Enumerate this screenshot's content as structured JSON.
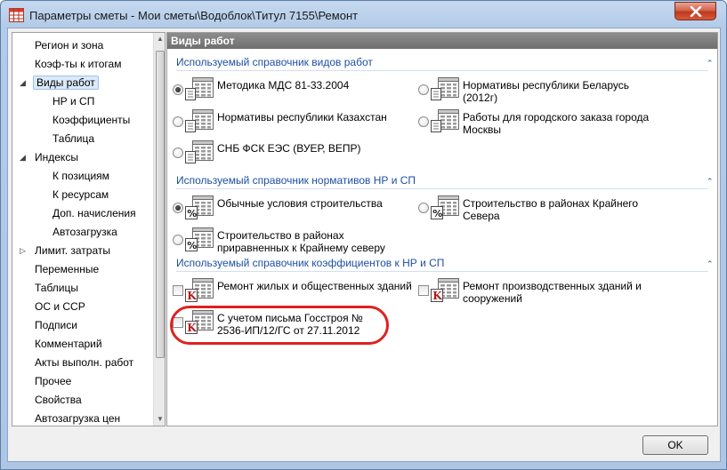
{
  "window": {
    "title": "Параметры сметы - Мои сметы\\Водоблок\\Титул 7155\\Ремонт"
  },
  "sidebar": {
    "items": [
      {
        "label": "Регион и зона",
        "level": 0,
        "expander": "",
        "selected": false
      },
      {
        "label": "Коэф-ты к итогам",
        "level": 0,
        "expander": "",
        "selected": false
      },
      {
        "label": "Виды работ",
        "level": 0,
        "expander": "expanded",
        "selected": true
      },
      {
        "label": "НР и СП",
        "level": 1,
        "expander": "",
        "selected": false
      },
      {
        "label": "Коэффициенты",
        "level": 1,
        "expander": "",
        "selected": false
      },
      {
        "label": "Таблица",
        "level": 1,
        "expander": "",
        "selected": false
      },
      {
        "label": "Индексы",
        "level": 0,
        "expander": "expanded",
        "selected": false
      },
      {
        "label": "К позициям",
        "level": 1,
        "expander": "",
        "selected": false
      },
      {
        "label": "К ресурсам",
        "level": 1,
        "expander": "",
        "selected": false
      },
      {
        "label": "Доп. начисления",
        "level": 1,
        "expander": "",
        "selected": false
      },
      {
        "label": "Автозагрузка",
        "level": 1,
        "expander": "",
        "selected": false
      },
      {
        "label": "Лимит. затраты",
        "level": 0,
        "expander": "collapsed",
        "selected": false
      },
      {
        "label": "Переменные",
        "level": 0,
        "expander": "",
        "selected": false
      },
      {
        "label": "Таблицы",
        "level": 0,
        "expander": "",
        "selected": false
      },
      {
        "label": "ОС и ССР",
        "level": 0,
        "expander": "",
        "selected": false
      },
      {
        "label": "Подписи",
        "level": 0,
        "expander": "",
        "selected": false
      },
      {
        "label": "Комментарий",
        "level": 0,
        "expander": "",
        "selected": false
      },
      {
        "label": "Акты выполн. работ",
        "level": 0,
        "expander": "",
        "selected": false
      },
      {
        "label": "Прочее",
        "level": 0,
        "expander": "",
        "selected": false
      },
      {
        "label": "Свойства",
        "level": 0,
        "expander": "",
        "selected": false
      },
      {
        "label": "Автозагрузка цен",
        "level": 0,
        "expander": "",
        "selected": false
      }
    ]
  },
  "panel": {
    "header": "Виды работ",
    "groups": [
      {
        "title": "Используемый справочник видов работ",
        "options": [
          {
            "label": "Методика МДС 81-33.2004",
            "type": "radio",
            "checked": true,
            "icon": "table-doc-icon"
          },
          {
            "label": "Нормативы республики Беларусь (2012г)",
            "type": "radio",
            "checked": false,
            "icon": "table-doc-icon"
          },
          {
            "label": "Нормативы республики Казахстан",
            "type": "radio",
            "checked": false,
            "icon": "table-doc-icon"
          },
          {
            "label": "Работы для городского заказа города Москвы",
            "type": "radio",
            "checked": false,
            "icon": "table-doc-icon"
          },
          {
            "label": "СНБ ФСК ЕЭС (ВУЕР, ВЕПР)",
            "type": "radio",
            "checked": false,
            "icon": "table-doc-icon"
          }
        ]
      },
      {
        "title": "Используемый справочник нормативов НР и СП",
        "options": [
          {
            "label": "Обычные условия строительства",
            "type": "radio",
            "checked": true,
            "icon": "percent-doc-icon"
          },
          {
            "label": "Строительство в районах Крайнего Севера",
            "type": "radio",
            "checked": false,
            "icon": "percent-doc-icon"
          },
          {
            "label": "Строительство в районах приравненных к Крайнему северу",
            "type": "radio",
            "checked": false,
            "icon": "percent-doc-icon"
          }
        ]
      },
      {
        "title": "Используемый справочник коэффициентов к НР и СП",
        "options": [
          {
            "label": "Ремонт жилых и общественных зданий",
            "type": "checkbox",
            "checked": false,
            "icon": "k-doc-icon"
          },
          {
            "label": "Ремонт производственных зданий и сооружений",
            "type": "checkbox",
            "checked": false,
            "icon": "k-doc-icon"
          },
          {
            "label": "С учетом письма Госстроя № 2536-ИП/12/ГС от 27.11.2012",
            "type": "checkbox",
            "checked": false,
            "icon": "k-doc-icon"
          }
        ]
      }
    ]
  },
  "footer": {
    "ok_label": "OK"
  },
  "colors": {
    "group_title": "#1e50a2",
    "highlight": "#e02020",
    "selection": "#dbe9f9"
  }
}
